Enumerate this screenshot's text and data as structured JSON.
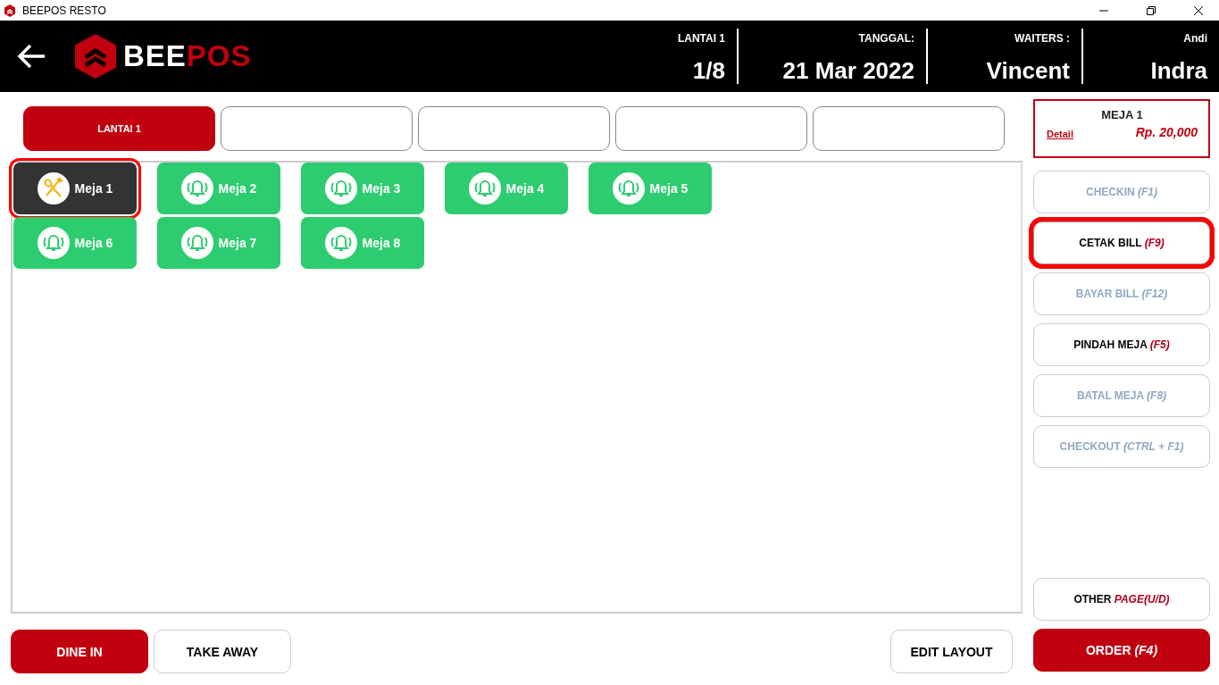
{
  "window": {
    "title": "BEEPOS RESTO"
  },
  "header": {
    "logo": {
      "part_1": "BEE",
      "part_2": "POS"
    },
    "info": [
      {
        "label": "LANTAI 1",
        "value": "1/8"
      },
      {
        "label": "TANGGAL:",
        "value": "21 Mar 2022"
      },
      {
        "label": "WAITERS :",
        "value": "Vincent"
      },
      {
        "label": "Andi",
        "value": "Indra"
      }
    ]
  },
  "floor_tabs": [
    {
      "label": "LANTAI 1",
      "selected": true
    },
    {
      "selected": false
    },
    {
      "selected": false
    },
    {
      "selected": false
    },
    {
      "selected": false
    }
  ],
  "tables": [
    {
      "name": "Meja 1",
      "kind": "occupied",
      "selected": true
    },
    {
      "name": "Meja 2",
      "kind": "available",
      "selected": false
    },
    {
      "name": "Meja 3",
      "kind": "available",
      "selected": false
    },
    {
      "name": "Meja 4",
      "kind": "available",
      "selected": false
    },
    {
      "name": "Meja 5",
      "kind": "available",
      "selected": false
    },
    {
      "name": "Meja 6",
      "kind": "available",
      "selected": false
    },
    {
      "name": "Meja 7",
      "kind": "available",
      "selected": false
    },
    {
      "name": "Meja 8",
      "kind": "available",
      "selected": false
    }
  ],
  "order_modes": [
    {
      "label": "DINE IN",
      "selected": true
    },
    {
      "label": "TAKE AWAY",
      "selected": false
    }
  ],
  "edit_layout": "EDIT LAYOUT",
  "table_card": {
    "title": "MEJA 1",
    "link": "Detail",
    "total": "Rp. 20,000"
  },
  "actions": [
    {
      "label": "CHECKIN",
      "key": "(F1)",
      "disabled": true,
      "highlighted": false
    },
    {
      "label": "CETAK BILL",
      "key": "(F9)",
      "disabled": false,
      "highlighted": true
    },
    {
      "label": "BAYAR BILL",
      "key": "(F12)",
      "disabled": true,
      "highlighted": false
    },
    {
      "label": "PINDAH MEJA",
      "key": "(F5)",
      "disabled": false,
      "highlighted": false
    },
    {
      "label": "BATAL MEJA",
      "key": "(F8)",
      "disabled": true,
      "highlighted": false
    },
    {
      "label": "CHECKOUT",
      "key": "(CTRL + F1)",
      "disabled": true,
      "highlighted": false
    }
  ],
  "other_page": {
    "label": "OTHER",
    "key": "PAGE(U/D)"
  },
  "order_button": {
    "label": "ORDER",
    "key": "(F4)"
  }
}
